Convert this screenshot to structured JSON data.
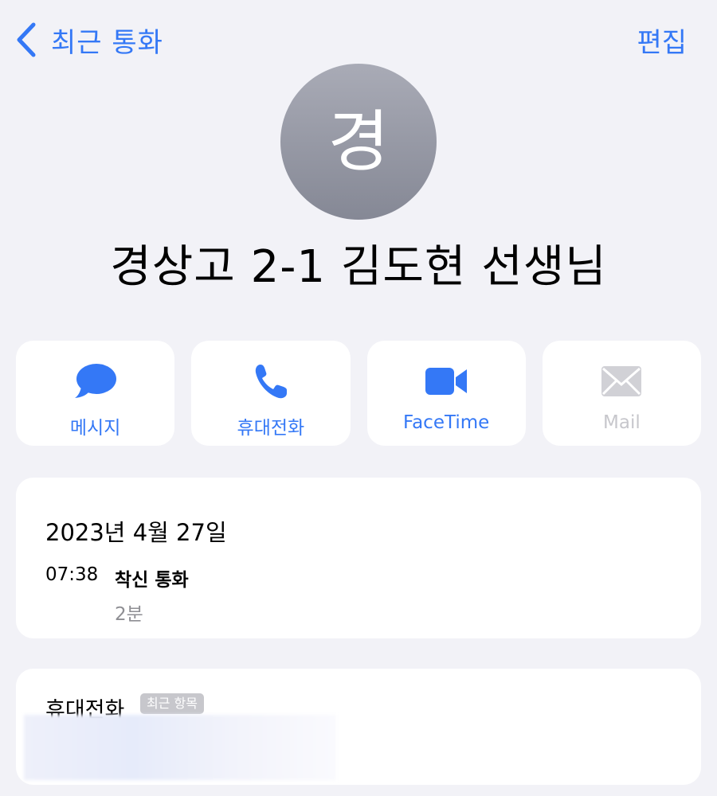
{
  "nav": {
    "back_label": "최근 통화",
    "edit_label": "편집"
  },
  "contact": {
    "initial": "경",
    "name": "경상고 2-1 김도현 선생님"
  },
  "actions": [
    {
      "label": "메시지",
      "icon": "message-icon",
      "enabled": true
    },
    {
      "label": "휴대전화",
      "icon": "phone-icon",
      "enabled": true
    },
    {
      "label": "FaceTime",
      "icon": "video-icon",
      "enabled": true
    },
    {
      "label": "Mail",
      "icon": "mail-icon",
      "enabled": false
    }
  ],
  "call_history": {
    "date": "2023년 4월 27일",
    "entries": [
      {
        "time": "07:38",
        "type": "착신 통화",
        "duration": "2분"
      }
    ]
  },
  "phone": {
    "label": "휴대전화",
    "badge": "최근 항목"
  },
  "colors": {
    "accent": "#3478f6",
    "background": "#f2f2f7",
    "disabled": "#c7c7cc",
    "secondary_text": "#8e8e93"
  }
}
